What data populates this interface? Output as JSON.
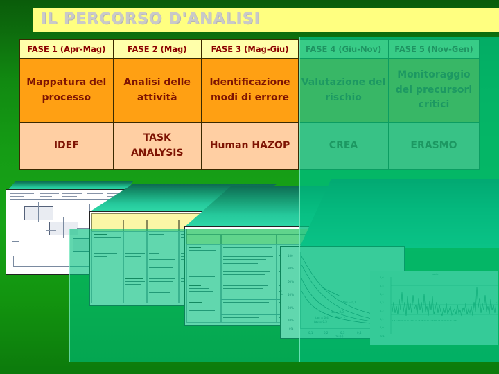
{
  "slide": {
    "title": "IL PERCORSO D'ANALISI",
    "background_color": "#13930f",
    "banner_color": "#ffff80",
    "title_color": "#c9c9c9"
  },
  "table": {
    "headers": [
      "FASE 1 (Apr-Mag)",
      "FASE 2 (Mag)",
      "FASE 3 (Mag-Giu)",
      "FASE 4 (Giu-Nov)",
      "FASE 5 (Nov-Gen)"
    ],
    "row_activity": [
      "Mappatura del processo",
      "Analisi delle attività",
      "Identificazione modi di errore",
      "Valutazione del rischio",
      "Monitoraggio dei precursori critici"
    ],
    "row_method": [
      "IDEF",
      "TASK ANALYSIS",
      "Human HAZOP",
      "CREA",
      "ERASMO"
    ],
    "header_bg": "#ffffaa",
    "header_text_color": "#8b0000",
    "activity_bg": "#ffa013",
    "method_bg": "#ffcfa3",
    "body_text_color": "#7e1403"
  },
  "thumbnails": [
    {
      "name": "idef-process-diagram"
    },
    {
      "name": "task-analysis-table"
    },
    {
      "name": "human-hazop-worksheet"
    },
    {
      "name": "crea-risk-curves-chart"
    },
    {
      "name": "erasmo-timeseries-chart"
    }
  ],
  "overlay": {
    "color": "#00be7d",
    "note": "translucent teal panel covering FASE 4 / FASE 5 columns and lower-right thumbnails"
  }
}
